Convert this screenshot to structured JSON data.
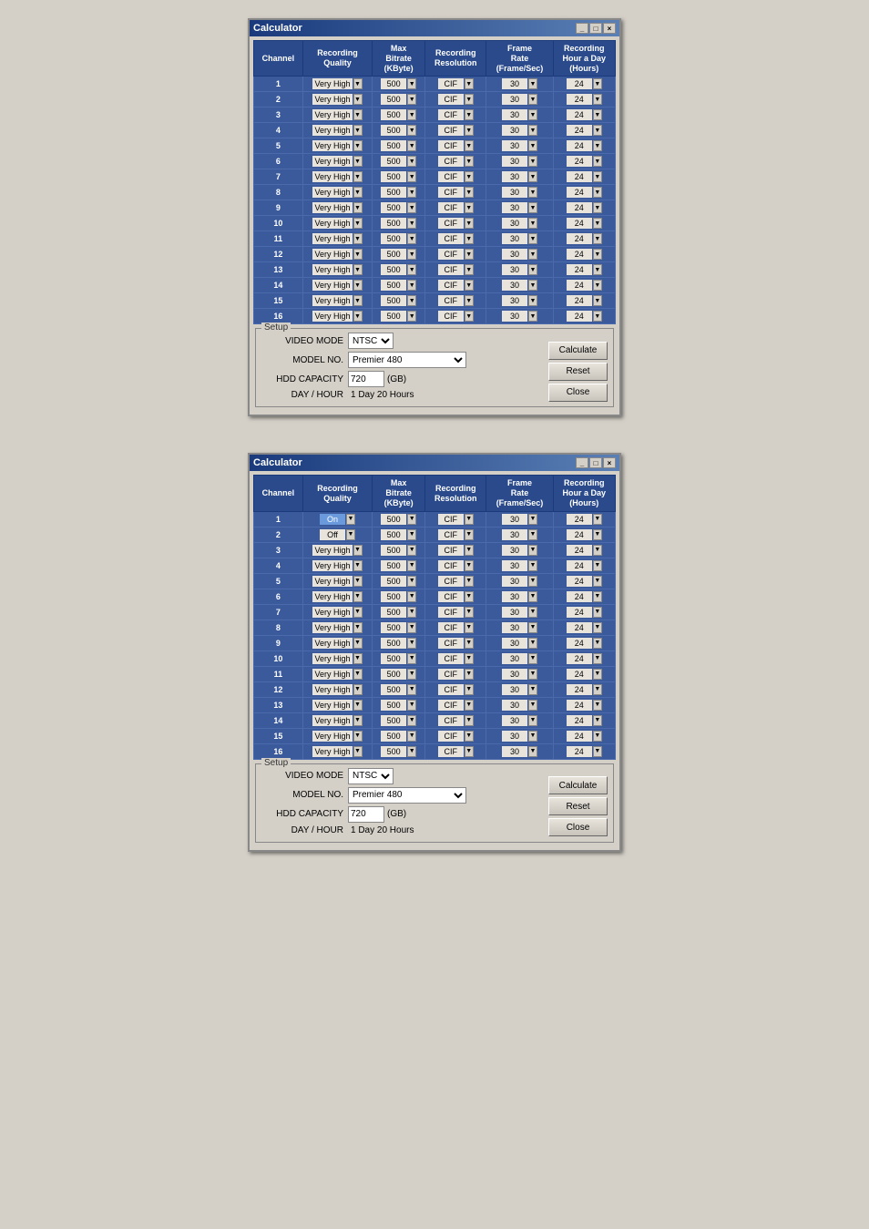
{
  "window1": {
    "title": "Calculator",
    "title_bar_buttons": [
      "_",
      "□",
      "×"
    ],
    "table": {
      "headers": [
        "Channel",
        "Recording\nQuality",
        "Max\nBitrate\n(KByte)",
        "Recording\nResolution",
        "Frame\nRate\n(Frame/Sec)",
        "Recording\nHour a Day\n(Hours)"
      ],
      "rows": [
        {
          "channel": "1",
          "quality": "Very High",
          "bitrate": "500",
          "resolution": "CIF",
          "framerate": "30",
          "hours": "24"
        },
        {
          "channel": "2",
          "quality": "Very High",
          "bitrate": "500",
          "resolution": "CIF",
          "framerate": "30",
          "hours": "24"
        },
        {
          "channel": "3",
          "quality": "Very High",
          "bitrate": "500",
          "resolution": "CIF",
          "framerate": "30",
          "hours": "24"
        },
        {
          "channel": "4",
          "quality": "Very High",
          "bitrate": "500",
          "resolution": "CIF",
          "framerate": "30",
          "hours": "24"
        },
        {
          "channel": "5",
          "quality": "Very High",
          "bitrate": "500",
          "resolution": "CIF",
          "framerate": "30",
          "hours": "24"
        },
        {
          "channel": "6",
          "quality": "Very High",
          "bitrate": "500",
          "resolution": "CIF",
          "framerate": "30",
          "hours": "24"
        },
        {
          "channel": "7",
          "quality": "Very High",
          "bitrate": "500",
          "resolution": "CIF",
          "framerate": "30",
          "hours": "24"
        },
        {
          "channel": "8",
          "quality": "Very High",
          "bitrate": "500",
          "resolution": "CIF",
          "framerate": "30",
          "hours": "24"
        },
        {
          "channel": "9",
          "quality": "Very High",
          "bitrate": "500",
          "resolution": "CIF",
          "framerate": "30",
          "hours": "24"
        },
        {
          "channel": "10",
          "quality": "Very High",
          "bitrate": "500",
          "resolution": "CIF",
          "framerate": "30",
          "hours": "24"
        },
        {
          "channel": "11",
          "quality": "Very High",
          "bitrate": "500",
          "resolution": "CIF",
          "framerate": "30",
          "hours": "24"
        },
        {
          "channel": "12",
          "quality": "Very High",
          "bitrate": "500",
          "resolution": "CIF",
          "framerate": "30",
          "hours": "24"
        },
        {
          "channel": "13",
          "quality": "Very High",
          "bitrate": "500",
          "resolution": "CIF",
          "framerate": "30",
          "hours": "24"
        },
        {
          "channel": "14",
          "quality": "Very High",
          "bitrate": "500",
          "resolution": "CIF",
          "framerate": "30",
          "hours": "24"
        },
        {
          "channel": "15",
          "quality": "Very High",
          "bitrate": "500",
          "resolution": "CIF",
          "framerate": "30",
          "hours": "24"
        },
        {
          "channel": "16",
          "quality": "Very High",
          "bitrate": "500",
          "resolution": "CIF",
          "framerate": "30",
          "hours": "24"
        }
      ]
    },
    "setup": {
      "legend": "Setup",
      "video_mode_label": "VIDEO MODE",
      "video_mode_value": "NTSC",
      "model_no_label": "MODEL NO.",
      "model_no_value": "Premier 480",
      "hdd_capacity_label": "HDD CAPACITY",
      "hdd_capacity_value": "720",
      "hdd_unit": "(GB)",
      "day_hour_label": "DAY / HOUR",
      "day_hour_value": "1 Day 20 Hours"
    },
    "buttons": {
      "calculate": "Calculate",
      "reset": "Reset",
      "close": "Close"
    }
  },
  "window2": {
    "title": "Calculator",
    "title_bar_buttons": [
      "_",
      "□",
      "×"
    ],
    "table": {
      "headers": [
        "Channel",
        "Recording\nQuality",
        "Max\nBitrate\n(KByte)",
        "Recording\nResolution",
        "Frame\nRate\n(Frame/Sec)",
        "Recording\nHour a Day\n(Hours)"
      ],
      "rows": [
        {
          "channel": "1",
          "quality": "On",
          "quality_dropdown": true,
          "quality_dropdown_text": "On",
          "bitrate": "500",
          "resolution": "CIF",
          "framerate": "30",
          "hours": "24"
        },
        {
          "channel": "2",
          "quality": "Off",
          "quality_dropdown": true,
          "quality_dropdown_text": "Off",
          "bitrate": "500",
          "resolution": "CIF",
          "framerate": "30",
          "hours": "24"
        },
        {
          "channel": "3",
          "quality": "Very High",
          "bitrate": "500",
          "resolution": "CIF",
          "framerate": "30",
          "hours": "24"
        },
        {
          "channel": "4",
          "quality": "Very High",
          "bitrate": "500",
          "resolution": "CIF",
          "framerate": "30",
          "hours": "24"
        },
        {
          "channel": "5",
          "quality": "Very High",
          "bitrate": "500",
          "resolution": "CIF",
          "framerate": "30",
          "hours": "24"
        },
        {
          "channel": "6",
          "quality": "Very High",
          "bitrate": "500",
          "resolution": "CIF",
          "framerate": "30",
          "hours": "24"
        },
        {
          "channel": "7",
          "quality": "Very High",
          "bitrate": "500",
          "resolution": "CIF",
          "framerate": "30",
          "hours": "24"
        },
        {
          "channel": "8",
          "quality": "Very High",
          "bitrate": "500",
          "resolution": "CIF",
          "framerate": "30",
          "hours": "24"
        },
        {
          "channel": "9",
          "quality": "Very High",
          "bitrate": "500",
          "resolution": "CIF",
          "framerate": "30",
          "hours": "24"
        },
        {
          "channel": "10",
          "quality": "Very High",
          "bitrate": "500",
          "resolution": "CIF",
          "framerate": "30",
          "hours": "24"
        },
        {
          "channel": "11",
          "quality": "Very High",
          "bitrate": "500",
          "resolution": "CIF",
          "framerate": "30",
          "hours": "24"
        },
        {
          "channel": "12",
          "quality": "Very High",
          "bitrate": "500",
          "resolution": "CIF",
          "framerate": "30",
          "hours": "24"
        },
        {
          "channel": "13",
          "quality": "Very High",
          "bitrate": "500",
          "resolution": "CIF",
          "framerate": "30",
          "hours": "24"
        },
        {
          "channel": "14",
          "quality": "Very High",
          "bitrate": "500",
          "resolution": "CIF",
          "framerate": "30",
          "hours": "24"
        },
        {
          "channel": "15",
          "quality": "Very High",
          "bitrate": "500",
          "resolution": "CIF",
          "framerate": "30",
          "hours": "24"
        },
        {
          "channel": "16",
          "quality": "Very High",
          "bitrate": "500",
          "resolution": "CIF",
          "framerate": "30",
          "hours": "24"
        }
      ]
    },
    "setup": {
      "legend": "Setup",
      "video_mode_label": "VIDEO MODE",
      "video_mode_value": "NTSC",
      "model_no_label": "MODEL NO.",
      "model_no_value": "Premier 480",
      "hdd_capacity_label": "HDD CAPACITY",
      "hdd_capacity_value": "720",
      "hdd_unit": "(GB)",
      "day_hour_label": "DAY / HOUR",
      "day_hour_value": "1 Day 20 Hours"
    },
    "buttons": {
      "calculate": "Calculate",
      "reset": "Reset",
      "close": "Close"
    }
  }
}
